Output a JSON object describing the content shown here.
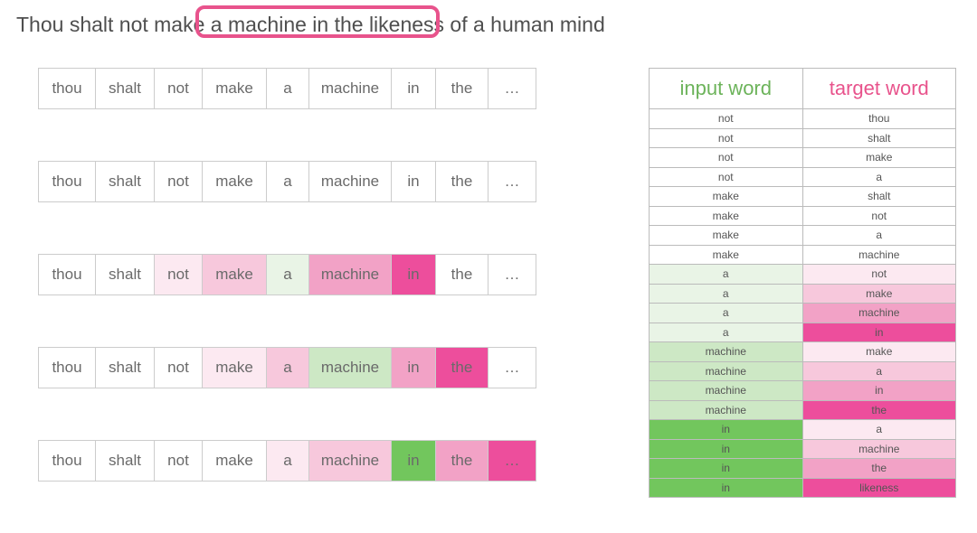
{
  "sentence": "Thou shalt not make a machine in the likeness of a human mind",
  "words": [
    "thou",
    "shalt",
    "not",
    "make",
    "a",
    "machine",
    "in",
    "the",
    "…"
  ],
  "widthClasses": [
    "w0",
    "w1",
    "w2",
    "w3",
    "w4",
    "w5",
    "w6",
    "w7",
    "w8"
  ],
  "rows": [
    {
      "colors": [
        "",
        "",
        "",
        "",
        "",
        "",
        "",
        "",
        ""
      ]
    },
    {
      "colors": [
        "",
        "",
        "",
        "",
        "",
        "",
        "",
        "",
        ""
      ]
    },
    {
      "colors": [
        "",
        "",
        "p0",
        "p1",
        "g0",
        "p2",
        "p3",
        "",
        ""
      ]
    },
    {
      "colors": [
        "",
        "",
        "",
        "p0",
        "p1",
        "g1",
        "p2",
        "p3",
        ""
      ]
    },
    {
      "colors": [
        "",
        "",
        "",
        "",
        "p0",
        "p1",
        "g3",
        "p2",
        "p3"
      ]
    }
  ],
  "table": {
    "headers": {
      "input": "input word",
      "target": "target word"
    },
    "rows": [
      {
        "input": "not",
        "target": "thou",
        "ic": "",
        "tc": ""
      },
      {
        "input": "not",
        "target": "shalt",
        "ic": "",
        "tc": ""
      },
      {
        "input": "not",
        "target": "make",
        "ic": "",
        "tc": ""
      },
      {
        "input": "not",
        "target": "a",
        "ic": "",
        "tc": ""
      },
      {
        "input": "make",
        "target": "shalt",
        "ic": "",
        "tc": ""
      },
      {
        "input": "make",
        "target": "not",
        "ic": "",
        "tc": ""
      },
      {
        "input": "make",
        "target": "a",
        "ic": "",
        "tc": ""
      },
      {
        "input": "make",
        "target": "machine",
        "ic": "",
        "tc": ""
      },
      {
        "input": "a",
        "target": "not",
        "ic": "g0",
        "tc": "p0"
      },
      {
        "input": "a",
        "target": "make",
        "ic": "g0",
        "tc": "p1"
      },
      {
        "input": "a",
        "target": "machine",
        "ic": "g0",
        "tc": "p2"
      },
      {
        "input": "a",
        "target": "in",
        "ic": "g0",
        "tc": "p3"
      },
      {
        "input": "machine",
        "target": "make",
        "ic": "g1",
        "tc": "p0"
      },
      {
        "input": "machine",
        "target": "a",
        "ic": "g1",
        "tc": "p1"
      },
      {
        "input": "machine",
        "target": "in",
        "ic": "g1",
        "tc": "p2"
      },
      {
        "input": "machine",
        "target": "the",
        "ic": "g1",
        "tc": "p3"
      },
      {
        "input": "in",
        "target": "a",
        "ic": "g3",
        "tc": "p0"
      },
      {
        "input": "in",
        "target": "machine",
        "ic": "g3",
        "tc": "p1"
      },
      {
        "input": "in",
        "target": "the",
        "ic": "g3",
        "tc": "p2"
      },
      {
        "input": "in",
        "target": "likeness",
        "ic": "g3",
        "tc": "p3"
      }
    ]
  }
}
